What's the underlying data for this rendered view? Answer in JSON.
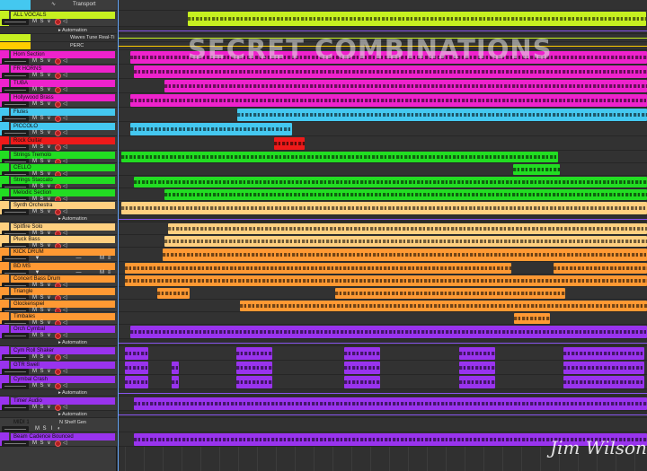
{
  "tracks": [
    {
      "name": "Transport",
      "type": "transport",
      "color": "#3c3c3c",
      "h": 12
    },
    {
      "name": "ALL VOCALS",
      "color": "#c6f020",
      "h": 18
    },
    {
      "name": "Automation",
      "type": "auto",
      "h": 8
    },
    {
      "name": "Waves Tune Real-Ti",
      "type": "plugin",
      "color": "#c6f020",
      "h": 9
    },
    {
      "name": "PERC",
      "type": "plugin",
      "color": "#ffcc00",
      "h": 9
    },
    {
      "name": "Horn Section",
      "color": "#ee22cc",
      "h": 16
    },
    {
      "name": "FR HORNS",
      "color": "#ee22cc",
      "h": 16
    },
    {
      "name": "TUBA",
      "color": "#ee22cc",
      "h": 16
    },
    {
      "name": "Hollywood Brass",
      "color": "#ee22cc",
      "h": 16
    },
    {
      "name": "Flutes",
      "color": "#44c8f0",
      "h": 16
    },
    {
      "name": "PICCOLO",
      "color": "#44c8f0",
      "h": 16
    },
    {
      "name": "Rock Guitar",
      "color": "#ee1a1a",
      "h": 16
    },
    {
      "name": "Strings Tremolo",
      "color": "#22dd22",
      "h": 14
    },
    {
      "name": "CELLO",
      "color": "#22dd22",
      "h": 14
    },
    {
      "name": "Strings Staccato",
      "color": "#22dd22",
      "h": 14
    },
    {
      "name": "Melodic Section",
      "color": "#22dd22",
      "h": 14
    },
    {
      "name": "Synth Orchestra",
      "color": "#ffd080",
      "h": 16
    },
    {
      "name": "Automation",
      "type": "auto",
      "h": 8
    },
    {
      "name": "Spitfire Solo",
      "color": "#ffd080",
      "h": 14
    },
    {
      "name": "Pluck Bass",
      "color": "#ffd080",
      "h": 14
    },
    {
      "name": "KICK DRUM",
      "type": "midi",
      "color": "#ff9933",
      "h": 16
    },
    {
      "name": "BD MS",
      "type": "midi",
      "color": "#ff9933",
      "h": 14
    },
    {
      "name": "Concert Bass Drum",
      "color": "#ff9933",
      "h": 14
    },
    {
      "name": "Triangle",
      "color": "#ff9933",
      "h": 14
    },
    {
      "name": "Glockenspiel",
      "color": "#ff9933",
      "h": 14
    },
    {
      "name": "Timbales",
      "color": "#ff9933",
      "h": 14
    },
    {
      "name": "Orch Cymbal",
      "color": "#9933ee",
      "h": 16
    },
    {
      "name": "Automation",
      "type": "auto",
      "h": 8
    },
    {
      "name": "Cym Roll Shaker",
      "color": "#9933ee",
      "h": 16
    },
    {
      "name": "GTR Swell",
      "color": "#9933ee",
      "h": 16
    },
    {
      "name": "Cymbal Crash",
      "color": "#9933ee",
      "h": 16
    },
    {
      "name": "Automation",
      "type": "auto",
      "h": 8
    },
    {
      "name": "Timer Audio",
      "color": "#9933ee",
      "h": 16
    },
    {
      "name": "Automation",
      "type": "auto",
      "h": 8
    },
    {
      "name": "MIDI 1",
      "type": "midi2",
      "color": "#3c3c3c",
      "h": 16
    },
    {
      "name": "Beam Cadence Bounced",
      "color": "#9933ee",
      "h": 16
    }
  ],
  "midi1_plugin": "N Shelf Gen",
  "labels": {
    "m": "M",
    "s": "S",
    "i": "I"
  },
  "overlay_title": "SECRET COMBINATIONS",
  "signature": "Jim Wilson"
}
